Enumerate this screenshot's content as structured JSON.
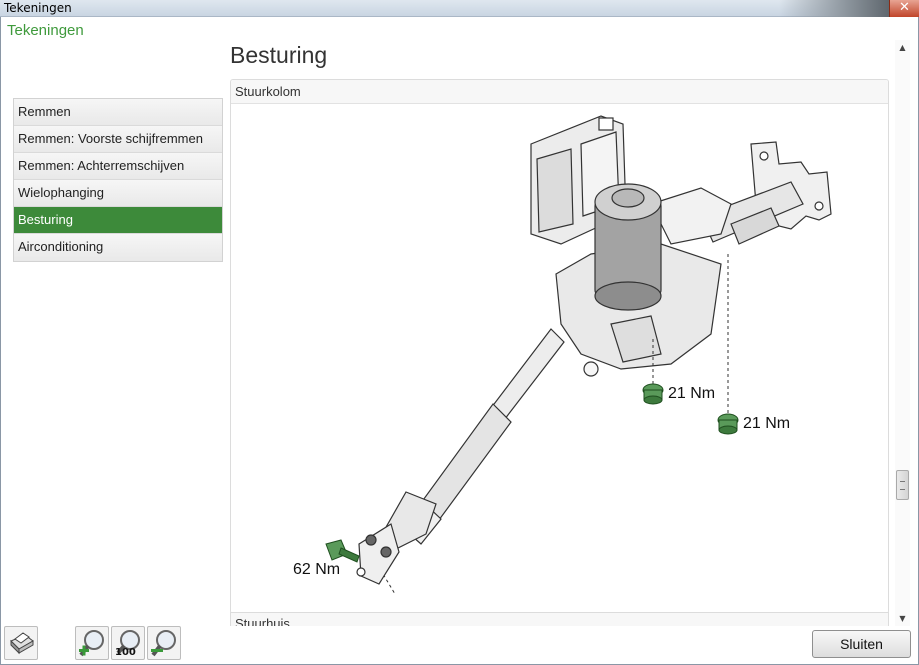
{
  "window": {
    "title": "Tekeningen",
    "close_label": "✕"
  },
  "app": {
    "title": "Tekeningen"
  },
  "sidebar": {
    "items": [
      {
        "label": "Remmen"
      },
      {
        "label": "Remmen: Voorste schijfremmen"
      },
      {
        "label": "Remmen: Achterremschijven"
      },
      {
        "label": "Wielophanging"
      },
      {
        "label": "Besturing",
        "active": true
      },
      {
        "label": "Airconditioning"
      }
    ]
  },
  "page": {
    "title": "Besturing"
  },
  "panel": {
    "header": "Stuurkolom",
    "torques": [
      "21 Nm",
      "21 Nm",
      "62 Nm"
    ]
  },
  "next_panel": {
    "header": "Stuurhuis"
  },
  "toolbar": {
    "zoom_reset_label": "100",
    "close_button": "Sluiten"
  },
  "colors": {
    "accent": "#3f9a3c",
    "active_item": "#3d8a3a",
    "bolt": "#5a9a5a"
  }
}
